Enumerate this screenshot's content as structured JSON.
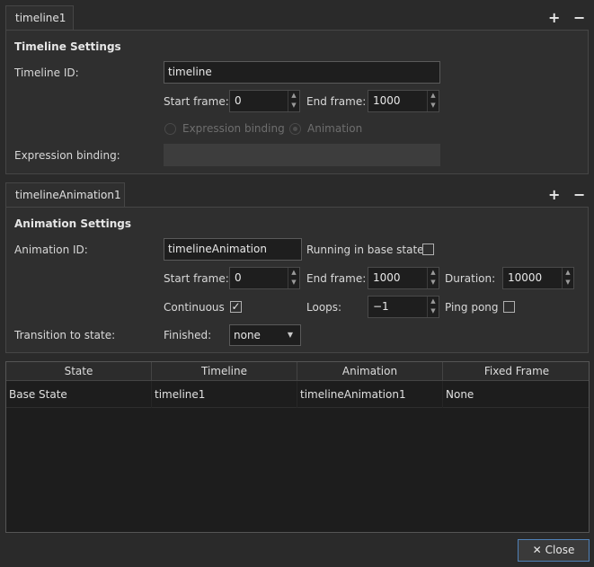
{
  "timeline": {
    "tab_label": "timeline1",
    "section_title": "Timeline Settings",
    "id_label": "Timeline ID:",
    "id_value": "timeline",
    "start_label": "Start frame:",
    "start_value": "0",
    "end_label": "End frame:",
    "end_value": "1000",
    "radio_expression": "Expression binding",
    "radio_animation": "Animation",
    "expression_label": "Expression binding:",
    "expression_value": ""
  },
  "animation": {
    "tab_label": "timelineAnimation1",
    "section_title": "Animation Settings",
    "id_label": "Animation ID:",
    "id_value": "timelineAnimation",
    "running_label": "Running in base state",
    "running_checked": false,
    "start_label": "Start frame:",
    "start_value": "0",
    "end_label": "End frame:",
    "end_value": "1000",
    "duration_label": "Duration:",
    "duration_value": "10000",
    "continuous_label": "Continuous",
    "continuous_checked": true,
    "loops_label": "Loops:",
    "loops_value": "−1",
    "pingpong_label": "Ping pong",
    "pingpong_checked": false,
    "transition_label": "Transition to state:",
    "finished_label": "Finished:",
    "finished_value": "none"
  },
  "icons": {
    "add": "+",
    "remove": "−",
    "check": "✓",
    "spin_up": "▲",
    "spin_down": "▼",
    "combo_arrow": "▼",
    "close": "✕"
  },
  "table": {
    "headers": [
      "State",
      "Timeline",
      "Animation",
      "Fixed Frame"
    ],
    "rows": [
      [
        "Base State",
        "timeline1",
        "timelineAnimation1",
        "None"
      ]
    ]
  },
  "footer": {
    "close_label": "Close"
  },
  "colors": {
    "background": "#2a2a2a",
    "panel": "#2f2f2f",
    "field": "#1e1e1e",
    "accent_border": "#4f81b8"
  }
}
